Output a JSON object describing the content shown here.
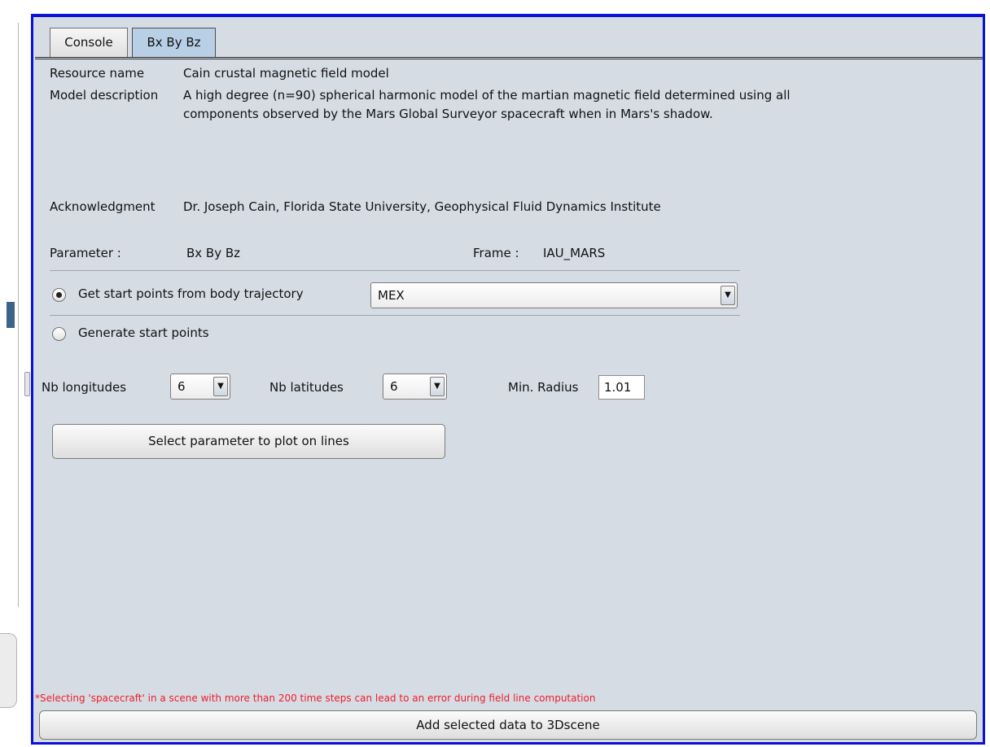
{
  "tabs": [
    {
      "label": "Console"
    },
    {
      "label": "Bx By Bz"
    }
  ],
  "resource": {
    "name_label": "Resource name",
    "name_value": "Cain crustal magnetic field model",
    "description_label": "Model description",
    "description_line1": "A high degree (n=90) spherical harmonic model of the martian magnetic field determined using all",
    "description_line2": "components observed by the Mars Global Surveyor spacecraft when in Mars's shadow.",
    "ack_label": "Acknowledgment",
    "ack_value": "Dr. Joseph Cain, Florida State University, Geophysical Fluid Dynamics Institute"
  },
  "parameter": {
    "label": "Parameter :",
    "value": "Bx By Bz",
    "frame_label": "Frame :",
    "frame_value": "IAU_MARS"
  },
  "start_points": {
    "option_trajectory": "Get start points from body trajectory",
    "trajectory_selected": true,
    "trajectory_value": "MEX",
    "option_generate": "Generate start points"
  },
  "grid": {
    "nb_longitudes_label": "Nb longitudes",
    "nb_longitudes_value": "6",
    "nb_latitudes_label": "Nb latitudes",
    "nb_latitudes_value": "6",
    "min_radius_label": "Min. Radius",
    "min_radius_value": "1.01"
  },
  "buttons": {
    "select_parameter": "Select parameter to plot on lines",
    "add_to_scene": "Add selected data to 3Dscene"
  },
  "warning": "*Selecting 'spacecraft' in a scene with more than 200 time steps can lead to an error during field line computation",
  "icons": {
    "combo_arrow": "▼"
  },
  "colors": {
    "focus_frame": "#0b11d6",
    "panel_bg": "#d6dce4",
    "active_tab": "#b8cfe5",
    "warning_text": "#ee1d2a"
  }
}
